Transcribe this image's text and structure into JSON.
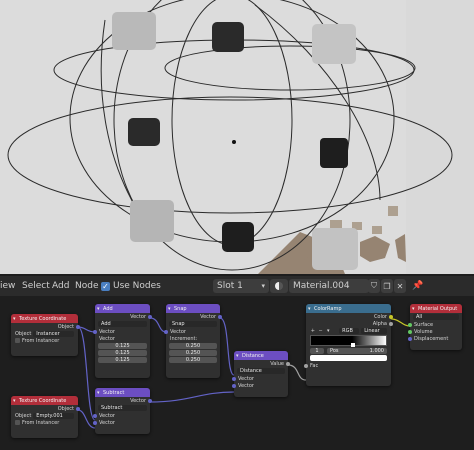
{
  "colors": {
    "header_bg": "#2b2b2b",
    "vector_node": "#6c4ec2",
    "texcoord_node": "#b22e3a",
    "colorramp_node": "#3a6d8e",
    "output_node": "#b22e3a",
    "vector_socket": "#6363c7",
    "color_socket": "#c7c729",
    "float_socket": "#a1a1a1",
    "shader_socket": "#63c763"
  },
  "header": {
    "menu_view": "iew",
    "menu_select": "Select",
    "menu_add": "Add",
    "menu_node": "Node",
    "use_nodes_label": "Use Nodes",
    "slot": "Slot 1",
    "material_name": "Material.004"
  },
  "nodes": {
    "texcoord1": {
      "title": "Texture Coordinate",
      "out": "Object",
      "obj_label": "Object",
      "obj_value": "Instancer",
      "from_instancer": "From Instancer"
    },
    "texcoord2": {
      "title": "Texture Coordinate",
      "out": "Object",
      "obj_label": "Object",
      "obj_value": "Empty.001",
      "from_instancer": "From Instancer"
    },
    "add": {
      "title": "Add",
      "out": "Vector",
      "op": "Add",
      "in1": "Vector",
      "in2": "Vector",
      "x": "0.125",
      "y": "0.125",
      "z": "0.125"
    },
    "snap": {
      "title": "Snap",
      "out": "Vector",
      "op": "Snap",
      "in1": "Vector",
      "inc": "Increment:",
      "x": "0.250",
      "y": "0.250",
      "z": "0.250"
    },
    "subtract": {
      "title": "Subtract",
      "out": "Vector",
      "op": "Subtract",
      "in1": "Vector",
      "in2": "Vector"
    },
    "distance": {
      "title": "Distance",
      "out": "Value",
      "op": "Distance",
      "in1": "Vector",
      "in2": "Vector"
    },
    "colorramp": {
      "title": "ColorRamp",
      "out1": "Color",
      "out2": "Alpha",
      "mode": "RGB",
      "interp": "Linear",
      "index": "1",
      "pos_label": "Pos",
      "pos_value": "1.000",
      "fac": "Fac"
    },
    "output": {
      "title": "Material Output",
      "target": "All",
      "in1": "Surface",
      "in2": "Volume",
      "in3": "Displacement"
    }
  }
}
